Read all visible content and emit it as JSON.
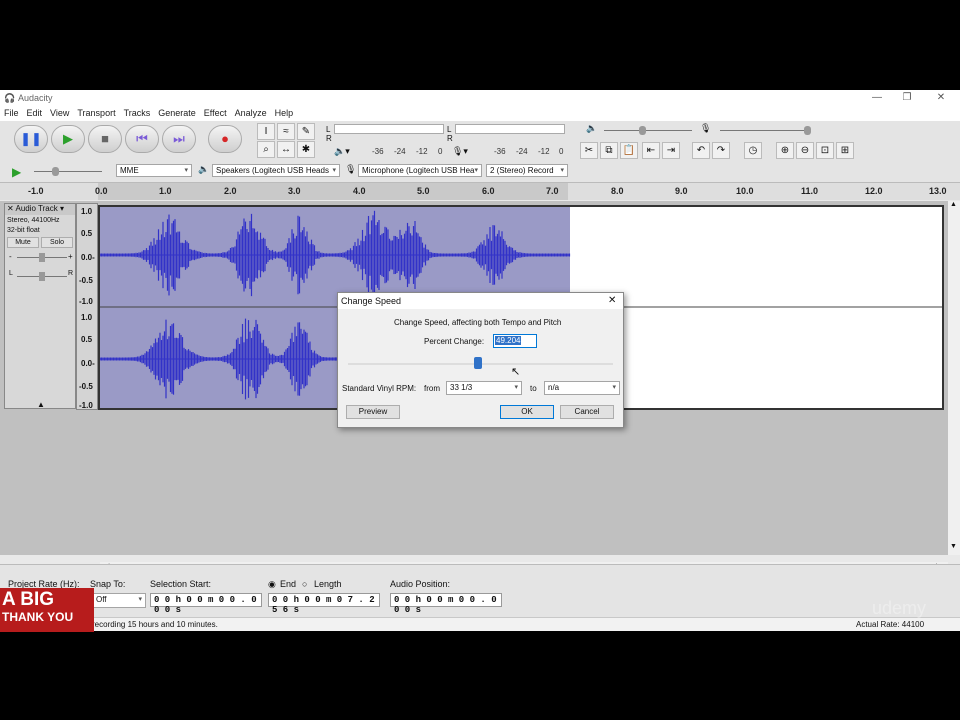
{
  "window": {
    "title": "Audacity",
    "min": "—",
    "max": "❐",
    "close": "✕"
  },
  "menu": [
    "File",
    "Edit",
    "View",
    "Transport",
    "Tracks",
    "Generate",
    "Effect",
    "Analyze",
    "Help"
  ],
  "meter": {
    "L": "L",
    "R": "R",
    "ticks": [
      "-36",
      "-24",
      "-12",
      "0"
    ]
  },
  "device": {
    "host": "MME",
    "output": "Speakers (Logitech USB Heads",
    "input": "Microphone (Logitech USB Hea",
    "channels": "2 (Stereo) Record"
  },
  "ruler": [
    "-1.0",
    "0.0",
    "1.0",
    "2.0",
    "3.0",
    "4.0",
    "5.0",
    "6.0",
    "7.0",
    "8.0",
    "9.0",
    "10.0",
    "11.0",
    "12.0",
    "13.0"
  ],
  "track": {
    "name": "Audio Track",
    "info1": "Stereo, 44100Hz",
    "info2": "32-bit float",
    "mute": "Mute",
    "solo": "Solo",
    "L": "L",
    "R": "R"
  },
  "scale": [
    "1.0",
    "0.5",
    "0.0-",
    "-0.5",
    "-1.0"
  ],
  "dialog": {
    "title": "Change Speed",
    "desc": "Change Speed, affecting both Tempo and Pitch",
    "percent_label": "Percent Change:",
    "percent_value": "49.204",
    "vinyl_label": "Standard Vinyl RPM:",
    "from_label": "from",
    "from_value": "33 1/3",
    "to_label": "to",
    "to_value": "n/a",
    "preview": "Preview",
    "ok": "OK",
    "cancel": "Cancel",
    "slider_value": 0.49
  },
  "status": {
    "rate_label": "Project Rate (Hz):",
    "snap_label": "Snap To:",
    "snap_value": "Off",
    "sel_start_label": "Selection Start:",
    "end_label": "End",
    "length_label": "Length",
    "audio_pos_label": "Audio Position:",
    "sel_start": "0 0 h 0 0 m 0 0 . 0 0 0 s",
    "sel_end": "0 0 h 0 0 m 0 7 . 2 5 6 s",
    "audio_pos": "0 0 h 0 0 m 0 0 . 0 0 0 s",
    "message": "recording 15 hours and 10 minutes.",
    "actual_rate": "Actual Rate: 44100"
  },
  "overlay": {
    "logo_line1": "A BIG",
    "logo_line2": "THANK YOU",
    "watermark": "udemy"
  },
  "colors": {
    "wave": "#3232c8",
    "selection": "#9a9ac6"
  }
}
